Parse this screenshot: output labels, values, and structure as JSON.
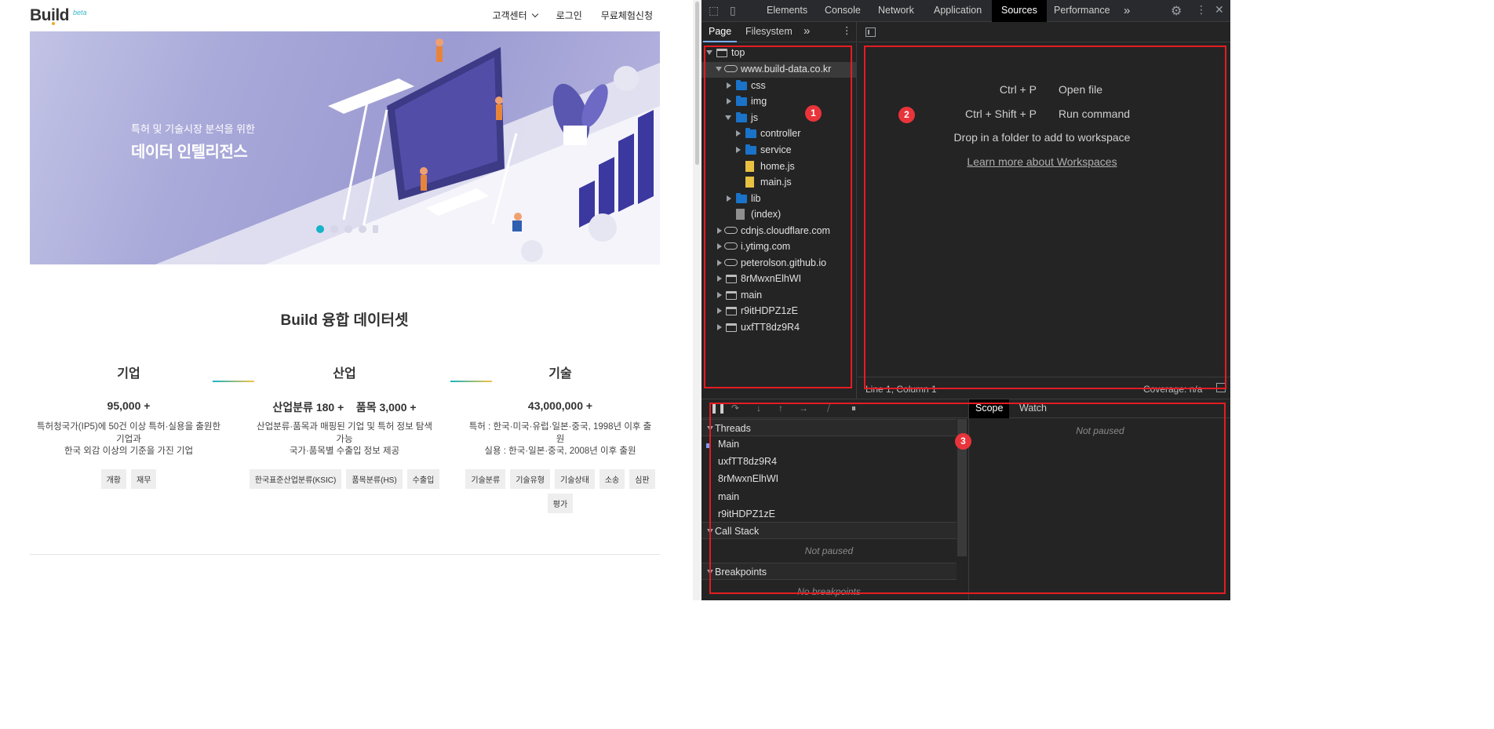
{
  "site": {
    "logo": "Build",
    "logo_badge": "beta",
    "nav": {
      "support": "고객센터",
      "login": "로그인",
      "trial": "무료체험신청"
    },
    "hero": {
      "subtitle": "특허 및 기술시장 분석을 위한",
      "title": "데이터 인텔리전스",
      "slides": 5,
      "active_slide": 1
    },
    "section_title": "Build 융합 데이터셋",
    "columns": [
      {
        "heading": "기업",
        "stat": "95,000 +",
        "desc_lines": [
          "특허청국가(IP5)에 50건 이상 특허·실용을 출원한",
          "기업과",
          "한국 외감 이상의 기준을 가진 기업"
        ],
        "tags": [
          "개황",
          "재무"
        ]
      },
      {
        "heading": "산업",
        "stat": "산업분류 180 +    품목 3,000 +",
        "desc_lines": [
          "산업분류·품목과 매핑된 기업 및 특허 정보 탐색",
          "가능",
          "국가·품목별 수출입 정보 제공"
        ],
        "tags": [
          "한국표준산업분류(KSIC)",
          "품목분류(HS)",
          "수출입"
        ]
      },
      {
        "heading": "기술",
        "stat": "43,000,000 +",
        "desc_lines": [
          "특허 : 한국·미국·유럽·일본·중국, 1998년 이후 출",
          "원",
          "실용 : 한국·일본·중국, 2008년 이후 출원"
        ],
        "tags": [
          "기술분류",
          "기술유형",
          "기술상태",
          "소송",
          "심판",
          "평가"
        ]
      }
    ],
    "colors": {
      "accent": "#17b3c6",
      "accent2": "#f5c342"
    }
  },
  "devtools": {
    "tabs": [
      "Elements",
      "Console",
      "Network",
      "Application",
      "Sources",
      "Performance"
    ],
    "active_tab": "Sources",
    "more": "»",
    "navigator_tabs": [
      "Page",
      "Filesystem"
    ],
    "tree": {
      "top": "top",
      "domain": "www.build-data.co.kr",
      "css": "css",
      "img": "img",
      "js": "js",
      "controller": "controller",
      "service": "service",
      "home": "home.js",
      "main_js": "main.js",
      "lib": "lib",
      "index": "(index)",
      "cdnjs": "cdnjs.cloudflare.com",
      "ytimg": "i.ytimg.com",
      "peterolson": "peterolson.github.io",
      "frame1": "8rMwxnElhWI",
      "frame2": "main",
      "frame3": "r9itHDPZ1zE",
      "frame4": "uxfTT8dz9R4"
    },
    "editor": {
      "open_file_key": "Ctrl + P",
      "open_file": "Open file",
      "run_cmd_key": "Ctrl + Shift + P",
      "run_cmd": "Run command",
      "drop_msg": "Drop in a folder to add to workspace",
      "learn_more": "Learn more about Workspaces",
      "status_left": "Line 1, Column 1",
      "status_right": "Coverage: n/a"
    },
    "debugger": {
      "threads_label": "Threads",
      "threads": [
        "Main",
        "uxfTT8dz9R4",
        "8rMwxnElhWI",
        "main",
        "r9itHDPZ1zE"
      ],
      "callstack_label": "Call Stack",
      "not_paused": "Not paused",
      "breakpoints_label": "Breakpoints",
      "no_breakpoints": "No breakpoints"
    },
    "scope": {
      "tabs": [
        "Scope",
        "Watch"
      ],
      "not_paused": "Not paused"
    }
  },
  "annotations": [
    "1",
    "2",
    "3"
  ]
}
